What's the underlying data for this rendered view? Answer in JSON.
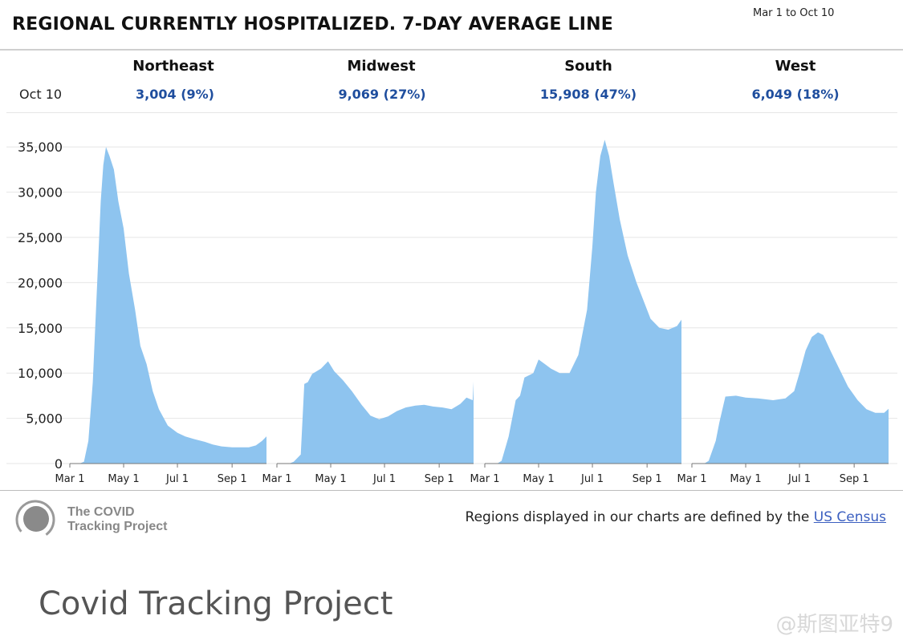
{
  "header": {
    "title": "REGIONAL CURRENTLY HOSPITALIZED. 7-DAY AVERAGE LINE",
    "date_range": "Mar 1 to Oct 10"
  },
  "summary": {
    "row_label": "Oct 10",
    "regions": [
      {
        "name": "Northeast",
        "value": "3,004 (9%)"
      },
      {
        "name": "Midwest",
        "value": "9,069 (27%)"
      },
      {
        "name": "South",
        "value": "15,908 (47%)"
      },
      {
        "name": "West",
        "value": "6,049 (18%)"
      }
    ]
  },
  "colors": {
    "area_fill": "#8ec4ef",
    "value_text": "#1f4e9e",
    "grid": "#e6e6e6"
  },
  "chart_data": {
    "type": "area",
    "title": "REGIONAL CURRENTLY HOSPITALIZED. 7-DAY AVERAGE LINE",
    "ylim": [
      0,
      37500
    ],
    "y_ticks": [
      0,
      5000,
      10000,
      15000,
      20000,
      25000,
      30000,
      35000
    ],
    "y_tick_labels": [
      "0",
      "5,000",
      "10,000",
      "15,000",
      "20,000",
      "25,000",
      "30,000",
      "35,000"
    ],
    "x_ticks": [
      "Mar 1",
      "May 1",
      "Jul 1",
      "Sep 1"
    ],
    "x_tick_dates": [
      "2020-03-01",
      "2020-05-01",
      "2020-07-01",
      "2020-09-01"
    ],
    "x_range": [
      "2020-03-01",
      "2020-10-10"
    ],
    "grid": true,
    "series": [
      {
        "name": "Northeast",
        "x": [
          "2020-03-01",
          "2020-03-12",
          "2020-03-17",
          "2020-03-22",
          "2020-03-27",
          "2020-04-01",
          "2020-04-05",
          "2020-04-08",
          "2020-04-11",
          "2020-04-15",
          "2020-04-20",
          "2020-04-25",
          "2020-05-01",
          "2020-05-07",
          "2020-05-14",
          "2020-05-20",
          "2020-05-27",
          "2020-06-03",
          "2020-06-10",
          "2020-06-20",
          "2020-07-01",
          "2020-07-10",
          "2020-07-20",
          "2020-08-01",
          "2020-08-10",
          "2020-08-20",
          "2020-09-01",
          "2020-09-10",
          "2020-09-20",
          "2020-09-28",
          "2020-10-05",
          "2020-10-10"
        ],
        "y": [
          0,
          0,
          200,
          2500,
          9000,
          20000,
          29000,
          33000,
          35000,
          34000,
          32500,
          29000,
          26000,
          21000,
          17000,
          13000,
          11000,
          8000,
          6000,
          4200,
          3400,
          3000,
          2700,
          2400,
          2100,
          1900,
          1800,
          1800,
          1800,
          2000,
          2500,
          3004
        ]
      },
      {
        "name": "Midwest",
        "x": [
          "2020-03-01",
          "2020-03-15",
          "2020-03-20",
          "2020-03-28",
          "2020-04-01",
          "2020-04-05",
          "2020-04-10",
          "2020-04-20",
          "2020-04-28",
          "2020-05-05",
          "2020-05-15",
          "2020-05-25",
          "2020-06-05",
          "2020-06-15",
          "2020-06-25",
          "2020-07-05",
          "2020-07-15",
          "2020-07-25",
          "2020-08-05",
          "2020-08-15",
          "2020-08-25",
          "2020-09-05",
          "2020-09-15",
          "2020-09-25",
          "2020-10-02",
          "2020-10-09",
          "2020-10-10"
        ],
        "y": [
          0,
          0,
          200,
          1000,
          8800,
          9000,
          9900,
          10500,
          11300,
          10200,
          9200,
          8000,
          6500,
          5300,
          4900,
          5200,
          5800,
          6200,
          6400,
          6500,
          6300,
          6200,
          6000,
          6600,
          7300,
          7000,
          9069
        ]
      },
      {
        "name": "South",
        "x": [
          "2020-03-01",
          "2020-03-15",
          "2020-03-20",
          "2020-03-28",
          "2020-04-05",
          "2020-04-10",
          "2020-04-15",
          "2020-04-25",
          "2020-05-01",
          "2020-05-08",
          "2020-05-15",
          "2020-05-25",
          "2020-06-05",
          "2020-06-15",
          "2020-06-25",
          "2020-07-01",
          "2020-07-05",
          "2020-07-10",
          "2020-07-15",
          "2020-07-20",
          "2020-07-25",
          "2020-08-01",
          "2020-08-10",
          "2020-08-20",
          "2020-08-28",
          "2020-09-05",
          "2020-09-15",
          "2020-09-25",
          "2020-10-05",
          "2020-10-10"
        ],
        "y": [
          0,
          0,
          300,
          3000,
          7000,
          7500,
          9500,
          10000,
          11500,
          11000,
          10500,
          10000,
          10000,
          12000,
          17000,
          24000,
          30000,
          34000,
          35800,
          34000,
          31000,
          27000,
          23000,
          20000,
          18000,
          16000,
          15000,
          14800,
          15200,
          15908
        ]
      },
      {
        "name": "West",
        "x": [
          "2020-03-01",
          "2020-03-15",
          "2020-03-20",
          "2020-03-28",
          "2020-04-01",
          "2020-04-08",
          "2020-04-20",
          "2020-05-01",
          "2020-05-15",
          "2020-06-01",
          "2020-06-15",
          "2020-06-25",
          "2020-07-01",
          "2020-07-08",
          "2020-07-15",
          "2020-07-22",
          "2020-07-28",
          "2020-08-05",
          "2020-08-15",
          "2020-08-25",
          "2020-09-05",
          "2020-09-15",
          "2020-09-25",
          "2020-10-05",
          "2020-10-10"
        ],
        "y": [
          0,
          0,
          300,
          2500,
          4500,
          7400,
          7500,
          7300,
          7200,
          7000,
          7200,
          8000,
          10000,
          12500,
          14000,
          14500,
          14200,
          12500,
          10500,
          8500,
          7000,
          6000,
          5600,
          5600,
          6049
        ]
      }
    ]
  },
  "footer": {
    "logo_line1": "The COVID",
    "logo_line2": "Tracking Project",
    "note_text": "Regions displayed in our charts are defined by the ",
    "note_link": "US Census"
  },
  "caption": "Covid Tracking Project",
  "watermark": "@斯图亚特9"
}
